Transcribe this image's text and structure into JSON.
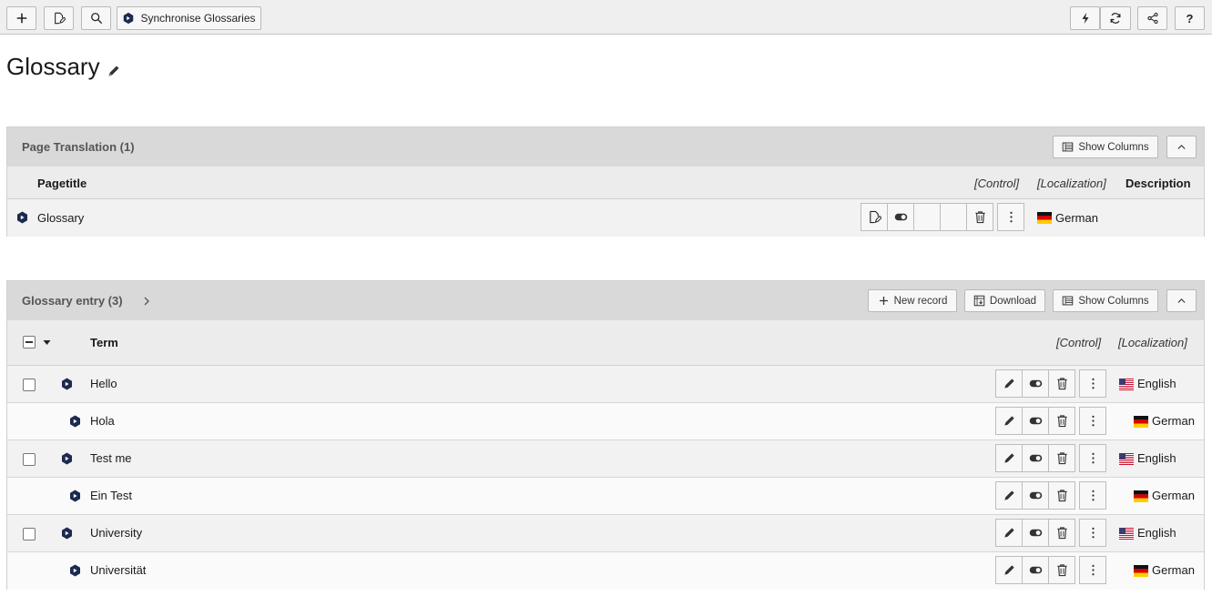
{
  "toolbar": {
    "sync_label": "Synchronise Glossaries",
    "help_label": "?"
  },
  "page": {
    "title": "Glossary"
  },
  "page_translation": {
    "title": "Page Translation (1)",
    "show_columns_label": "Show Columns",
    "columns": {
      "pagetitle": "Pagetitle",
      "control": "[Control]",
      "localization": "[Localization]",
      "description": "Description"
    },
    "row": {
      "title": "Glossary",
      "language": "German"
    }
  },
  "glossary_entry": {
    "title": "Glossary entry (3)",
    "new_record_label": "New record",
    "download_label": "Download",
    "show_columns_label": "Show Columns",
    "columns": {
      "term": "Term",
      "control": "[Control]",
      "localization": "[Localization]"
    },
    "rows": [
      {
        "term": "Hello",
        "language": "English",
        "is_translation": false
      },
      {
        "term": "Hola",
        "language": "German",
        "is_translation": true
      },
      {
        "term": "Test me",
        "language": "English",
        "is_translation": false
      },
      {
        "term": "Ein Test",
        "language": "German",
        "is_translation": true
      },
      {
        "term": "University",
        "language": "English",
        "is_translation": false
      },
      {
        "term": "Universität",
        "language": "German",
        "is_translation": true
      }
    ]
  },
  "colors": {
    "accent_icon": "#1b2a4e",
    "header_bg": "#d9d9d9",
    "toolbar_bg": "#efefef"
  }
}
